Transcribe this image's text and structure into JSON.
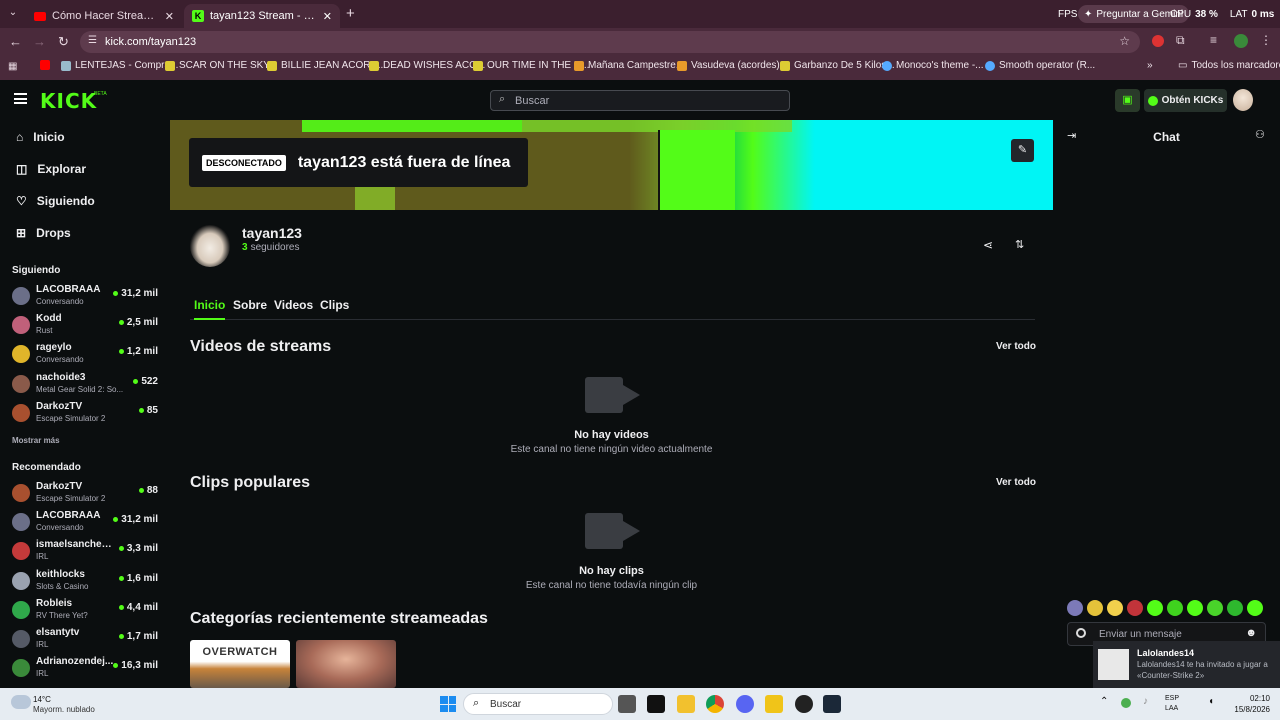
{
  "browser": {
    "tabs": [
      {
        "title": "Cómo Hacer Streams en Kick [C"
      },
      {
        "title": "tayan123 Stream - Watch Live o"
      }
    ],
    "overlay_stats": {
      "fps_label": "FPS",
      "cpu_label": "CPU",
      "cpu_value": "38 %",
      "lat_label": "LAT",
      "lat_value": "0 ms",
      "gemini_label": "Preguntar a Gemini"
    },
    "url": "kick.com/tayan123",
    "bookmarks": [
      "LENTEJAS - Compra...",
      "SCAR ON THE SKY...",
      "BILLIE JEAN ACORD...",
      "DEAD WISHES ACO...",
      "OUR TIME IN THE U...",
      "Mañana Campestre...",
      "Vasudeva (acordes)...",
      "Garbanzo De 5 Kilos...",
      "Monoco's theme -...",
      "Smooth operator (R..."
    ],
    "all_bookmarks": "Todos los marcadores"
  },
  "header": {
    "logo": "KICK",
    "logo_badge": "BETA",
    "search_placeholder": "Buscar",
    "get_kicks": "Obtén KICKs"
  },
  "sidebar": {
    "nav": [
      {
        "label": "Inicio",
        "icon": "home-icon"
      },
      {
        "label": "Explorar",
        "icon": "compass-icon"
      },
      {
        "label": "Siguiendo",
        "icon": "heart-icon"
      },
      {
        "label": "Drops",
        "icon": "gift-icon"
      }
    ],
    "following_title": "Siguiendo",
    "following": [
      {
        "name": "LACOBRAAA",
        "sub": "Conversando",
        "viewers": "31,2 mil",
        "color": "#6b6f88"
      },
      {
        "name": "Kodd",
        "sub": "Rust",
        "viewers": "2,5 mil",
        "color": "#c0607a"
      },
      {
        "name": "rageylo",
        "sub": "Conversando",
        "viewers": "1,2 mil",
        "color": "#e0b52a"
      },
      {
        "name": "nachoide3",
        "sub": "Metal Gear Solid 2: So...",
        "viewers": "522",
        "color": "#8a5a4a"
      },
      {
        "name": "DarkozTV",
        "sub": "Escape Simulator 2",
        "viewers": "85",
        "color": "#a8502f"
      }
    ],
    "show_more": "Mostrar más",
    "recommended_title": "Recomendado",
    "recommended": [
      {
        "name": "DarkozTV",
        "sub": "Escape Simulator 2",
        "viewers": "88",
        "color": "#a8502f"
      },
      {
        "name": "LACOBRAAA",
        "sub": "Conversando",
        "viewers": "31,2 mil",
        "color": "#6b6f88"
      },
      {
        "name": "ismaelsanchez18",
        "sub": "IRL",
        "viewers": "3,3 mil",
        "color": "#c43a3a"
      },
      {
        "name": "keithlocks",
        "sub": "Slots & Casino",
        "viewers": "1,6 mil",
        "color": "#9aa2b0"
      },
      {
        "name": "Robleis",
        "sub": "RV There Yet?",
        "viewers": "4,4 mil",
        "color": "#2fa84a"
      },
      {
        "name": "elsantytv",
        "sub": "IRL",
        "viewers": "1,7 mil",
        "color": "#555a66"
      },
      {
        "name": "Adrianozendej...",
        "sub": "IRL",
        "viewers": "16,3 mil",
        "color": "#3a8a3a"
      }
    ]
  },
  "banner": {
    "status_badge": "DESCONECTADO",
    "offline_text": "tayan123 está fuera de línea"
  },
  "channel": {
    "name": "tayan123",
    "followers_count": "3",
    "followers_label": "seguidores",
    "tabs": [
      "Inicio",
      "Sobre",
      "Videos",
      "Clips"
    ],
    "active_tab": "Inicio"
  },
  "sections": {
    "videos_title": "Videos de streams",
    "videos_see_all": "Ver todo",
    "no_videos": "No hay videos",
    "no_videos_sub": "Este canal no tiene ningún video actualmente",
    "clips_title": "Clips populares",
    "clips_see_all": "Ver todo",
    "no_clips": "No hay clips",
    "no_clips_sub": "Este canal no tiene todavía ningún clip",
    "categories_title": "Categorías recientemente streameadas",
    "category_1": "OVERWATCH"
  },
  "chat": {
    "title": "Chat",
    "input_placeholder": "Enviar un mensaje"
  },
  "notification": {
    "user": "Lalolandes14",
    "message": "Lalolandes14 te ha invitado a jugar a «Counter-Strike 2»"
  },
  "taskbar": {
    "weather_temp": "14°C",
    "weather_desc": "Mayorm. nublado",
    "search": "Buscar",
    "lang": "ESP",
    "lang2": "LAA",
    "time": "02:10",
    "date": "15/8/2026"
  }
}
